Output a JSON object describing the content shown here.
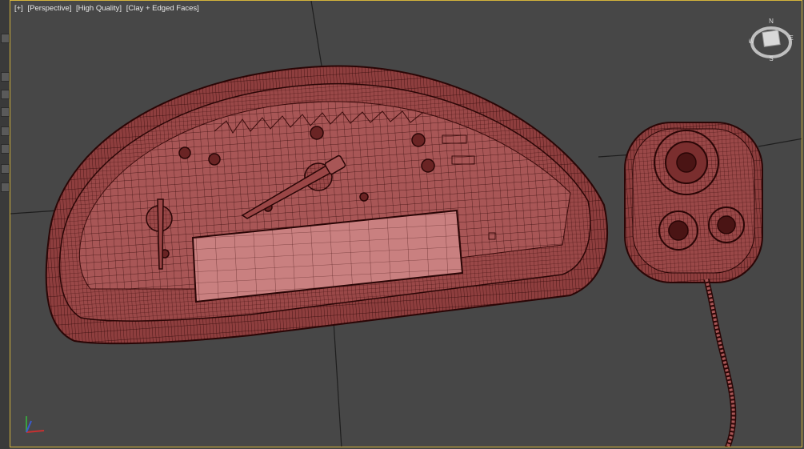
{
  "viewport": {
    "labels": [
      "[+]",
      "[Perspective]",
      "[High Quality]",
      "[Clay + Edged Faces]"
    ]
  },
  "viewcube": {
    "north": "N",
    "south": "S",
    "east": "E",
    "west": "W",
    "face": "top"
  },
  "colors": {
    "background": "#474747",
    "active_border": "#d4b43c",
    "clay": "#a85656",
    "wire": "#3c0f0f"
  },
  "scene": {
    "objects": [
      "instrument-cluster",
      "control-knob-panel",
      "cable"
    ]
  }
}
